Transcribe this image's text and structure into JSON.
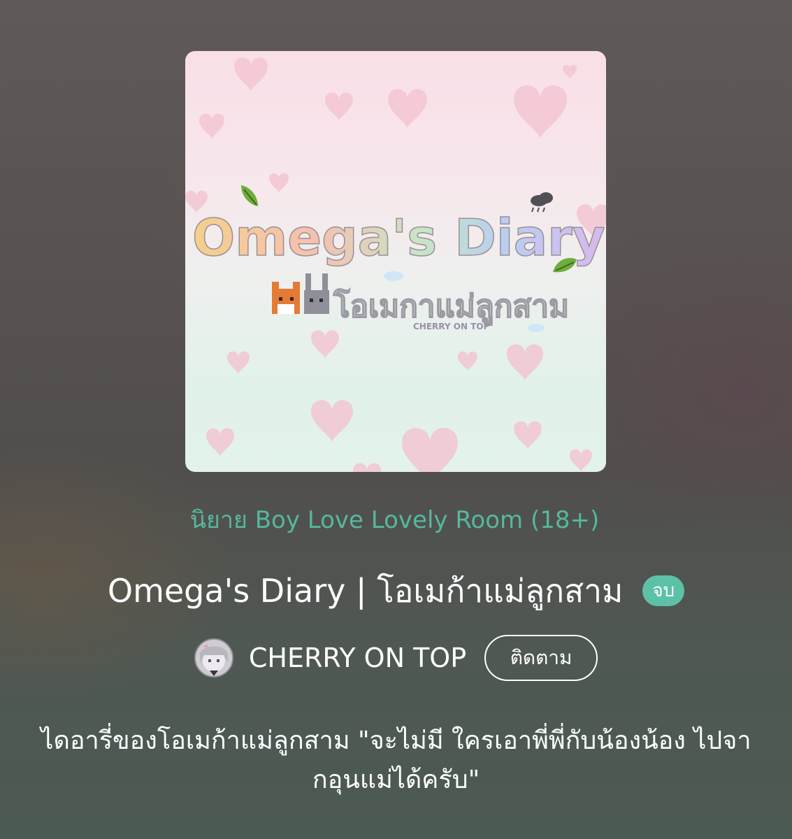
{
  "cover": {
    "art_title": "Omega's Diary",
    "art_subtitle": "โอเมกาแม่ลูกสาม",
    "art_credit": "CHERRY ON TOP",
    "icons": [
      "heart-icon",
      "leaf-icon",
      "cloud-icon",
      "fox-icon",
      "rabbit-icon"
    ]
  },
  "category": "นิยาย Boy Love Lovely Room (18+)",
  "title": "Omega's Diary | โอเมก้าแม่ลูกสาม",
  "status_badge": "จบ",
  "author": {
    "name": "CHERRY ON TOP",
    "avatar_icon": "avatar-icon"
  },
  "follow_button": "ติดตาม",
  "description": "ไดอารี่ของโอเมก้าแม่ลูกสาม \"จะไม่มี ใครเอาพี่พี่กับน้องน้อง ไปจากอุนแม่ได้ครับ\"",
  "colors": {
    "accent": "#56b79f",
    "badge": "#5cc1a7",
    "text": "#ffffff"
  }
}
